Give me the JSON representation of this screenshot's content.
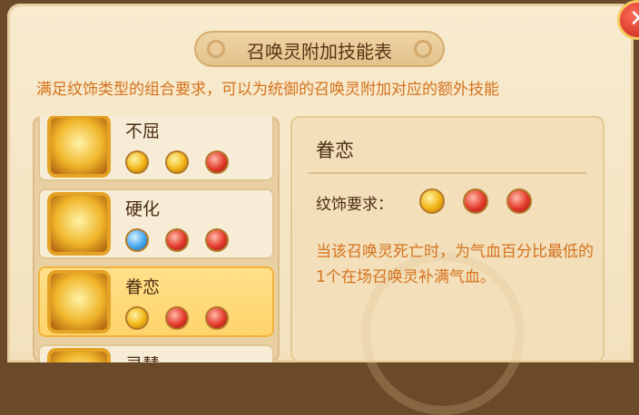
{
  "title": "召唤灵附加技能表",
  "subtitle": "满足纹饰类型的组合要求，可以为统御的召唤灵附加对应的额外技能",
  "close_glyph": "✕",
  "skills": [
    {
      "name": "不屈",
      "icon": "summon-warrior-icon",
      "gems": [
        "gold",
        "gold",
        "red"
      ]
    },
    {
      "name": "硬化",
      "icon": "golden-burst-icon",
      "gems": [
        "blue",
        "red",
        "red"
      ]
    },
    {
      "name": "眷恋",
      "icon": "summon-creature-icon",
      "gems": [
        "gold",
        "red",
        "red"
      ],
      "selected": true
    },
    {
      "name": "灵慧",
      "icon": "summon-spirit-icon",
      "gems": []
    }
  ],
  "detail": {
    "name": "眷恋",
    "requirement_label": "纹饰要求：",
    "requirement_gems": [
      "gold",
      "red",
      "red"
    ],
    "description": "当该召唤灵死亡时，为气血百分比最低的1个在场召唤灵补满气血。"
  },
  "colors": {
    "gold_gem": "#f2b516",
    "red_gem": "#e33a2a",
    "blue_gem": "#46a8ef",
    "accent_text": "#d4721d",
    "selected_bg": "#ffd36a"
  }
}
